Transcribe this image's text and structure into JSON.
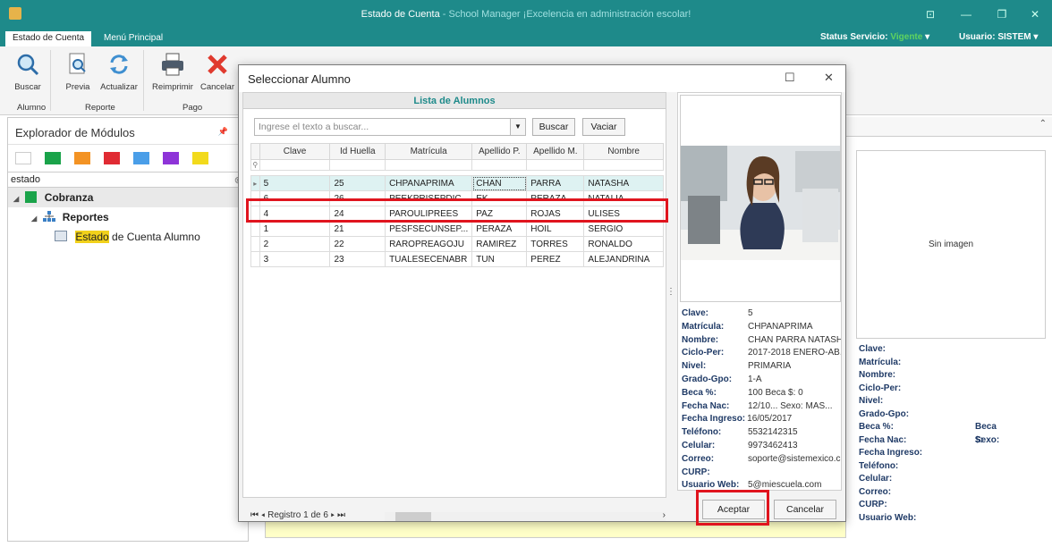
{
  "window": {
    "title": "Estado de Cuenta",
    "subtitle": " - School Manager ¡Excelencia en administración escolar!"
  },
  "tabs": [
    "Estado de Cuenta",
    "Menú Principal"
  ],
  "status": {
    "service_label": "Status Servicio:",
    "service_value": "Vigente",
    "user_label": "Usuario:",
    "user_value": "SISTEM"
  },
  "ribbon": {
    "buttons": [
      "Buscar",
      "Previa",
      "Actualizar",
      "Reimprimir",
      "Cancelar"
    ],
    "groups": [
      "Alumno",
      "Reporte",
      "Pago"
    ]
  },
  "explorer": {
    "title": "Explorador de Módulos",
    "colors": [
      "#ffffff",
      "#1aa34a",
      "#f39324",
      "#e02b33",
      "#4a9ee8",
      "#8e34d8",
      "#f2da1c"
    ],
    "search_value": "estado",
    "tree": {
      "root": "Cobranza",
      "child": "Reportes",
      "leaf_highlight": "Estado",
      "leaf_rest": " de Cuenta Alumno"
    }
  },
  "modal": {
    "title": "Seleccionar Alumno",
    "list_title": "Lista de Alumnos",
    "search_placeholder": "Ingrese el texto a buscar...",
    "search_button": "Buscar",
    "clear_button": "Vaciar",
    "columns": [
      "Clave",
      "Id Huella",
      "Matrícula",
      "Apellido P.",
      "Apellido M.",
      "Nombre"
    ],
    "rows": [
      [
        "5",
        "25",
        "CHPANAPRIMA",
        "CHAN",
        "PARRA",
        "NATASHA"
      ],
      [
        "6",
        "26",
        "PEEKPRISEPDIC",
        "EK",
        "PERAZA",
        "NATALIA"
      ],
      [
        "4",
        "24",
        "PAROULIPREES",
        "PAZ",
        "ROJAS",
        "ULISES"
      ],
      [
        "1",
        "21",
        "PESFSECUNSEP...",
        "PERAZA",
        "HOIL",
        "SERGIO"
      ],
      [
        "2",
        "22",
        "RAROPREAGOJU",
        "RAMIREZ",
        "TORRES",
        "RONALDO"
      ],
      [
        "3",
        "23",
        "TUALESECENABR",
        "TUN",
        "PEREZ",
        "ALEJANDRINA"
      ]
    ],
    "pager_text": "Registro 1 de 6",
    "details": [
      [
        "Clave:",
        "5"
      ],
      [
        "Matrícula:",
        "CHPANAPRIMA"
      ],
      [
        "Nombre:",
        "CHAN PARRA NATASHA"
      ],
      [
        "Ciclo-Per:",
        "2017-2018 ENERO-AB..."
      ],
      [
        "Nivel:",
        "PRIMARIA"
      ],
      [
        "Grado-Gpo:",
        "1-A"
      ],
      [
        "Beca %:",
        "100  Beca $:   0"
      ],
      [
        "Fecha Nac:",
        "12/10...  Sexo:  MAS..."
      ],
      [
        "Fecha Ingreso:",
        "16/05/2017"
      ],
      [
        "Teléfono:",
        "5532142315"
      ],
      [
        "Celular:",
        "9973462413"
      ],
      [
        "Correo:",
        "soporte@sistemexico.c..."
      ],
      [
        "CURP:",
        ""
      ],
      [
        "Usuario Web:",
        "5@miescuela.com"
      ]
    ],
    "accept_button": "Aceptar",
    "cancel_button": "Cancelar"
  },
  "background_panel": {
    "no_image": "Sin imagen",
    "fields": [
      "Clave:",
      "Matrícula:",
      "Nombre:",
      "Ciclo-Per:",
      "Nivel:",
      "Grado-Gpo:",
      "Beca %:",
      "Fecha Nac:",
      "Fecha Ingreso:",
      "Teléfono:",
      "Celular:",
      "Correo:",
      "CURP:",
      "Usuario Web:"
    ],
    "extra_fields": [
      "Beca $:",
      "Sexo:"
    ]
  }
}
